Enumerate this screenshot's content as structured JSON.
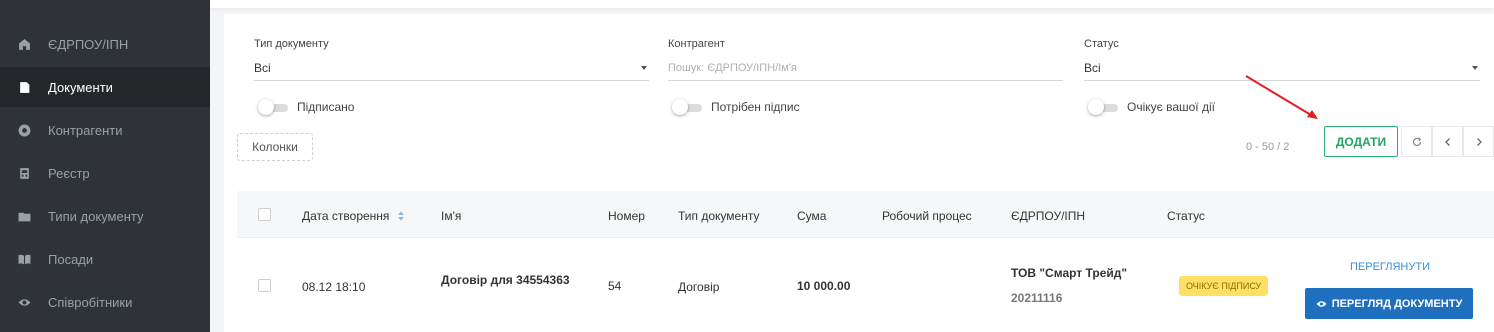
{
  "sidebar": {
    "items": [
      {
        "label": "ЄДРПОУ/ІПН",
        "icon": "building-icon"
      },
      {
        "label": "Документи",
        "icon": "document-icon"
      },
      {
        "label": "Контрагенти",
        "icon": "coin-icon"
      },
      {
        "label": "Реєстр",
        "icon": "register-icon"
      },
      {
        "label": "Типи документу",
        "icon": "folder-icon"
      },
      {
        "label": "Посади",
        "icon": "book-icon"
      },
      {
        "label": "Співробітники",
        "icon": "eye-icon"
      }
    ]
  },
  "filters": {
    "doc_type": {
      "label": "Тип документу",
      "value": "Всі"
    },
    "counterparty": {
      "label": "Контрагент",
      "placeholder": "Пошук: ЄДРПОУ/ІПН/Ім'я"
    },
    "status": {
      "label": "Статус",
      "value": "Всі"
    }
  },
  "toggles": {
    "signed": "Підписано",
    "need_signature": "Потрібен підпис",
    "awaiting_action": "Очікує вашої дії"
  },
  "toolbar": {
    "columns_label": "Колонки",
    "paging": "0 - 50 / 2",
    "add_label": "ДОДАТИ"
  },
  "table": {
    "headers": {
      "created": "Дата створення",
      "name": "Ім'я",
      "number": "Номер",
      "doc_type": "Тип документу",
      "amount": "Сума",
      "workflow": "Робочий процес",
      "edrpou": "ЄДРПОУ/ІПН",
      "status": "Статус"
    },
    "rows": [
      {
        "created": "08.12 18:10",
        "name": "Договір для 34554363",
        "number": "54",
        "doc_type": "Договір",
        "amount": "10 000.00",
        "company": "ТОВ \"Смарт Трейд\"",
        "edrpou": "20211116",
        "status": "ОЧІКУЄ ПІДПИСУ",
        "view_label": "ПЕРЕГЛЯНУТИ",
        "view_doc_label": "ПЕРЕГЛЯД ДОКУМЕНТУ"
      }
    ]
  },
  "colors": {
    "sidebar_bg": "#2f3337",
    "sidebar_active": "#23272a",
    "accent_green": "#1fa563",
    "accent_blue": "#1e6fbe",
    "badge_yellow": "#ffe066",
    "annotation_arrow": "#e02020"
  }
}
